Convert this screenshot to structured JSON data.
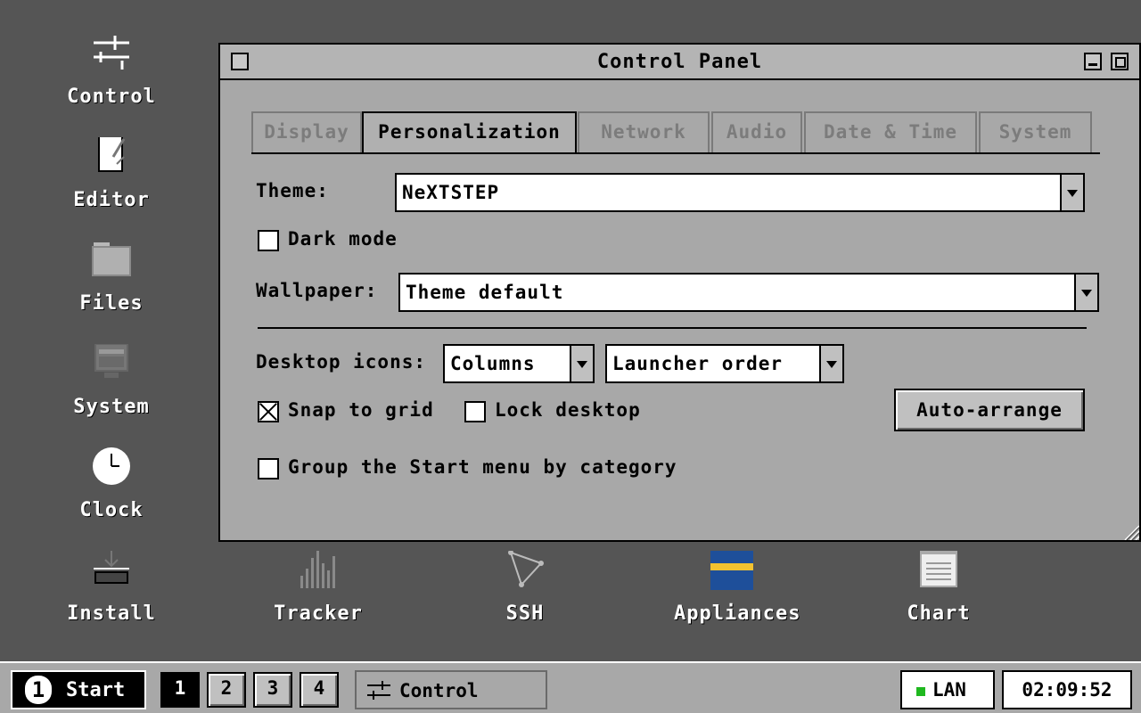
{
  "desktop": {
    "left_icons": [
      {
        "label": "Control",
        "icon": "sliders-icon"
      },
      {
        "label": "Editor",
        "icon": "document-edit-icon"
      },
      {
        "label": "Files",
        "icon": "folder-icon"
      },
      {
        "label": "System",
        "icon": "monitor-icon"
      },
      {
        "label": "Clock",
        "icon": "clock-icon"
      },
      {
        "label": "Install",
        "icon": "download-icon"
      }
    ],
    "bottom_icons": [
      {
        "label": "Tracker",
        "icon": "bar-graph-icon"
      },
      {
        "label": "SSH",
        "icon": "network-triangle-icon"
      },
      {
        "label": "Appliances",
        "icon": "flag-icon"
      },
      {
        "label": "Chart",
        "icon": "chart-document-icon"
      }
    ]
  },
  "window": {
    "title": "Control Panel",
    "tabs": [
      {
        "label": "Display",
        "active": false
      },
      {
        "label": "Personalization",
        "active": true
      },
      {
        "label": "Network",
        "active": false
      },
      {
        "label": "Audio",
        "active": false
      },
      {
        "label": "Date & Time",
        "active": false
      },
      {
        "label": "System",
        "active": false
      }
    ],
    "theme_label": "Theme:",
    "theme_value": "NeXTSTEP",
    "dark_mode_label": "Dark mode",
    "dark_mode_checked": false,
    "wallpaper_label": "Wallpaper:",
    "wallpaper_value": "Theme default",
    "desktop_icons_label": "Desktop icons:",
    "icons_layout_value": "Columns",
    "icons_order_value": "Launcher order",
    "snap_label": "Snap to grid",
    "snap_checked": true,
    "lock_label": "Lock desktop",
    "lock_checked": false,
    "auto_arrange_label": "Auto-arrange",
    "group_label": "Group the Start menu by category",
    "group_checked": false
  },
  "taskbar": {
    "start_label": "Start",
    "start_number": "1",
    "workspaces": [
      "1",
      "2",
      "3",
      "4"
    ],
    "current_workspace": "1",
    "task_label": "Control",
    "network_label": "LAN",
    "network_status_color": "#1fb81f",
    "clock": "02:09:52"
  },
  "colors": {
    "desktop": "#555555",
    "window": "#a8a8a8",
    "appliances_blue": "#1e4f9a",
    "appliances_yellow": "#f2c230"
  }
}
